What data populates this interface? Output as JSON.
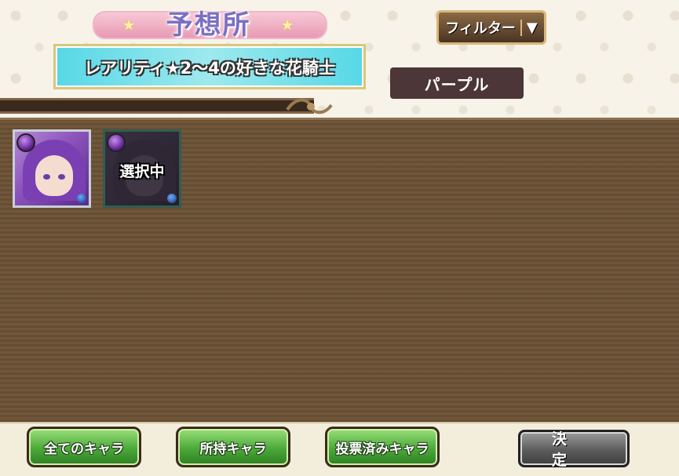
{
  "header": {
    "title": "予想所",
    "condition": "レアリティ★2～4の好きな花騎士",
    "filter_label": "フィルター",
    "filter_arrow": "▼",
    "attribute_chip": "パープル"
  },
  "roster": [
    {
      "state": "available",
      "attribute": "purple"
    },
    {
      "state": "selected",
      "attribute": "purple",
      "label": "選択中"
    }
  ],
  "footer": {
    "all_chars": "全てのキャラ",
    "owned_chars": "所持キャラ",
    "voted_chars": "投票済みキャラ",
    "confirm": "決定"
  },
  "colors": {
    "board": "#6c5236",
    "chip": "#4c3638",
    "condition_bg": "#56d8e6",
    "green_button": "#4ba93a",
    "purple_attr": "#8b52b9"
  }
}
